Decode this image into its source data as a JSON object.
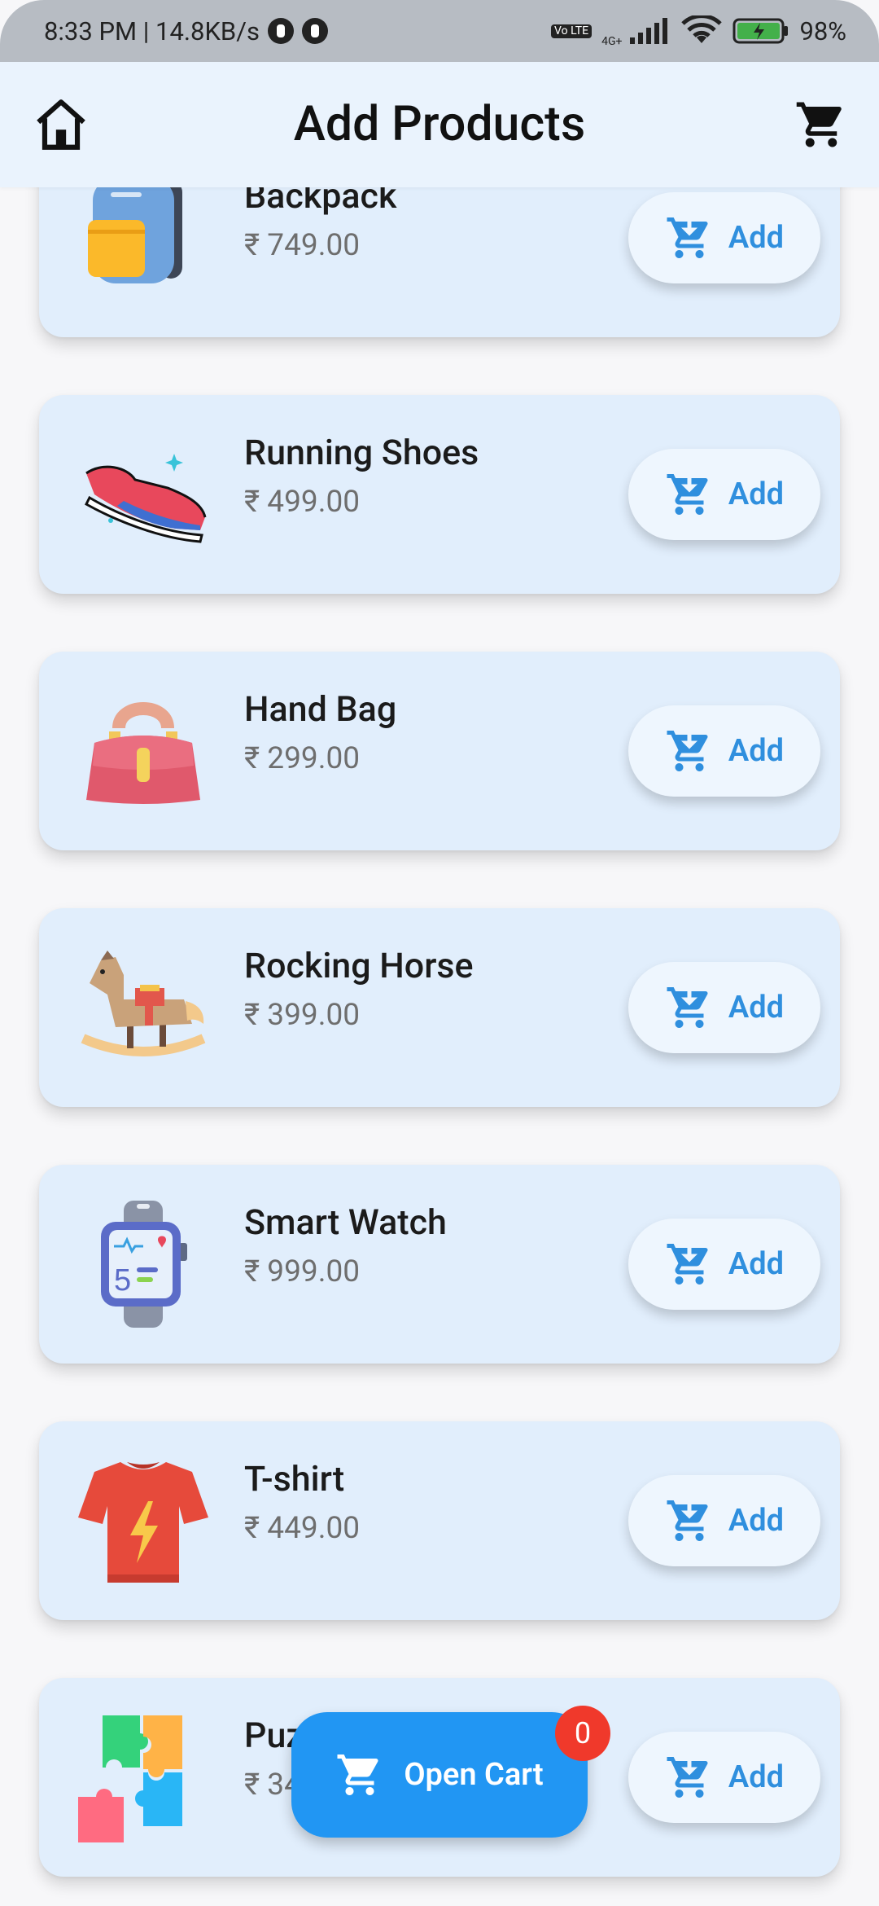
{
  "status_bar": {
    "time_speed": "8:33 PM | 14.8KB/s",
    "network": "4G+",
    "sim": "Vo LTE",
    "battery": "98%"
  },
  "app_bar": {
    "title": "Add Products"
  },
  "products": [
    {
      "name": "Backpack",
      "price": "₹ 749.00",
      "add_label": "Add"
    },
    {
      "name": "Running Shoes",
      "price": "₹ 499.00",
      "add_label": "Add"
    },
    {
      "name": "Hand Bag",
      "price": "₹ 299.00",
      "add_label": "Add"
    },
    {
      "name": "Rocking Horse",
      "price": "₹ 399.00",
      "add_label": "Add"
    },
    {
      "name": "Smart Watch",
      "price": "₹ 999.00",
      "add_label": "Add"
    },
    {
      "name": "T-shirt",
      "price": "₹ 449.00",
      "add_label": "Add"
    },
    {
      "name": "Puzzle",
      "price": "₹ 349.00",
      "add_label": "Add"
    }
  ],
  "fab": {
    "label": "Open Cart",
    "badge_count": "0"
  },
  "colors": {
    "accent": "#2196f3",
    "card": "#e1eefc",
    "appbar": "#eaf3fd",
    "badge": "#f0392b",
    "add_text": "#2f8fde"
  }
}
